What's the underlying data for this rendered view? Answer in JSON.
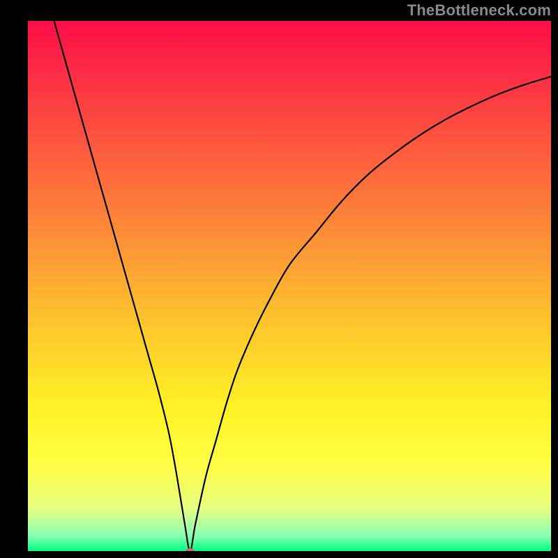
{
  "watermark": "TheBottleneck.com",
  "chart_data": {
    "type": "line",
    "title": "",
    "xlabel": "",
    "ylabel": "",
    "xlim": [
      0,
      100
    ],
    "ylim": [
      0,
      100
    ],
    "grid": false,
    "legend": false,
    "background_gradient": {
      "stops": [
        {
          "offset": 0,
          "color": "#fc0e48"
        },
        {
          "offset": 35,
          "color": "#fd7c3a"
        },
        {
          "offset": 55,
          "color": "#fdbf2e"
        },
        {
          "offset": 73,
          "color": "#fef225"
        },
        {
          "offset": 84,
          "color": "#ffff46"
        },
        {
          "offset": 92,
          "color": "#e6ff82"
        },
        {
          "offset": 97,
          "color": "#8cffb4"
        },
        {
          "offset": 100,
          "color": "#00ff82"
        }
      ]
    },
    "series": [
      {
        "name": "curve",
        "x": [
          5,
          7,
          9,
          11,
          13,
          15,
          17,
          19,
          21,
          23,
          25,
          27,
          28.5,
          30,
          31,
          32,
          34,
          36,
          38,
          40,
          43,
          46,
          50,
          55,
          60,
          65,
          70,
          75,
          80,
          85,
          90,
          95,
          100
        ],
        "y": [
          100,
          93,
          86,
          79,
          72,
          65,
          58,
          51,
          44,
          37,
          30,
          22,
          14,
          5,
          0,
          5,
          14,
          21,
          28,
          34,
          41,
          47,
          54,
          60,
          66,
          71,
          75,
          78.5,
          81.5,
          84,
          86.2,
          88,
          89.5
        ]
      }
    ],
    "marker": {
      "x": 31,
      "y": 0,
      "color": "#c86e6e",
      "rx": 6,
      "ry": 4
    }
  }
}
